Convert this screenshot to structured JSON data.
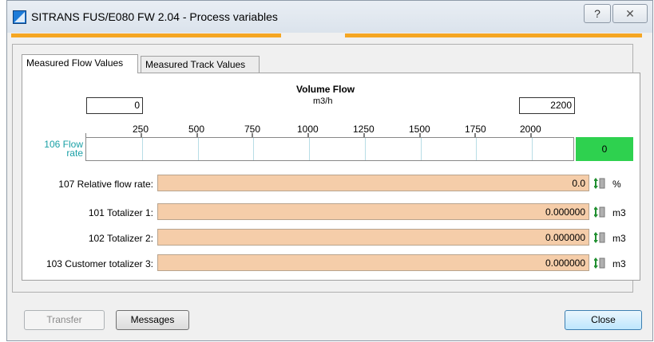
{
  "window": {
    "title": "SITRANS FUS/E080 FW 2.04 - Process variables",
    "help_label": "?",
    "close_label": "✕"
  },
  "tabs": [
    {
      "label": "Measured Flow Values",
      "active": true
    },
    {
      "label": "Measured Track Values",
      "active": false
    }
  ],
  "chart": {
    "title": "Volume Flow",
    "unit": "m3/h",
    "range_min": "0",
    "range_max": "2200",
    "scale_labels": [
      "250",
      "500",
      "750",
      "1000",
      "1250",
      "1500",
      "1750",
      "2000"
    ],
    "series_label": "106 Flow rate",
    "current_value": "0",
    "value_color": "#2ed14f"
  },
  "rows": [
    {
      "label": "107  Relative flow rate:",
      "value": "0.0",
      "unit": "%",
      "icon": "sort-arrows-icon"
    },
    {
      "label": "101  Totalizer 1:",
      "value": "0.000000",
      "unit": "m3",
      "icon": "sort-arrows-icon"
    },
    {
      "label": "102  Totalizer 2:",
      "value": "0.000000",
      "unit": "m3",
      "icon": "sort-arrows-icon"
    },
    {
      "label": "103  Customer totalizer 3:",
      "value": "0.000000",
      "unit": "m3",
      "icon": "sort-arrows-icon"
    }
  ],
  "buttons": {
    "transfer": "Transfer",
    "messages": "Messages",
    "close": "Close"
  },
  "colors": {
    "accent_orange": "#f5a623",
    "field_fill": "#f5cda9",
    "flow_label": "#1aa0a6"
  }
}
